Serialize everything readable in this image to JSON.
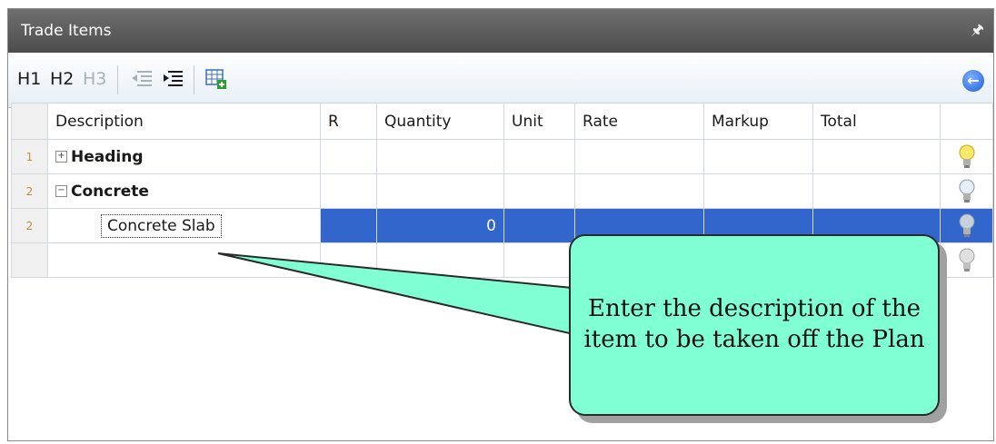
{
  "panel": {
    "title": "Trade Items"
  },
  "toolbar": {
    "h1": "H1",
    "h2": "H2",
    "h3": "H3"
  },
  "grid": {
    "headers": [
      "",
      "Description",
      "R",
      "Quantity",
      "Unit",
      "Rate",
      "Markup",
      "Total",
      ""
    ],
    "rows": [
      {
        "num": "1",
        "description": "Heading",
        "quantity": "",
        "expander": "+"
      },
      {
        "num": "2",
        "description": "Concrete",
        "quantity": "",
        "expander": "−"
      },
      {
        "num": "2",
        "description": "Concrete Slab",
        "quantity": "0",
        "selected": true
      },
      {
        "num": "",
        "description": "",
        "quantity": ""
      }
    ]
  },
  "callout": {
    "text": "Enter the description of the item to be taken off the Plan"
  },
  "colors": {
    "selection": "#3366cc",
    "callout_fill": "#80ffd4",
    "titlebar": "#5a5a5a"
  }
}
